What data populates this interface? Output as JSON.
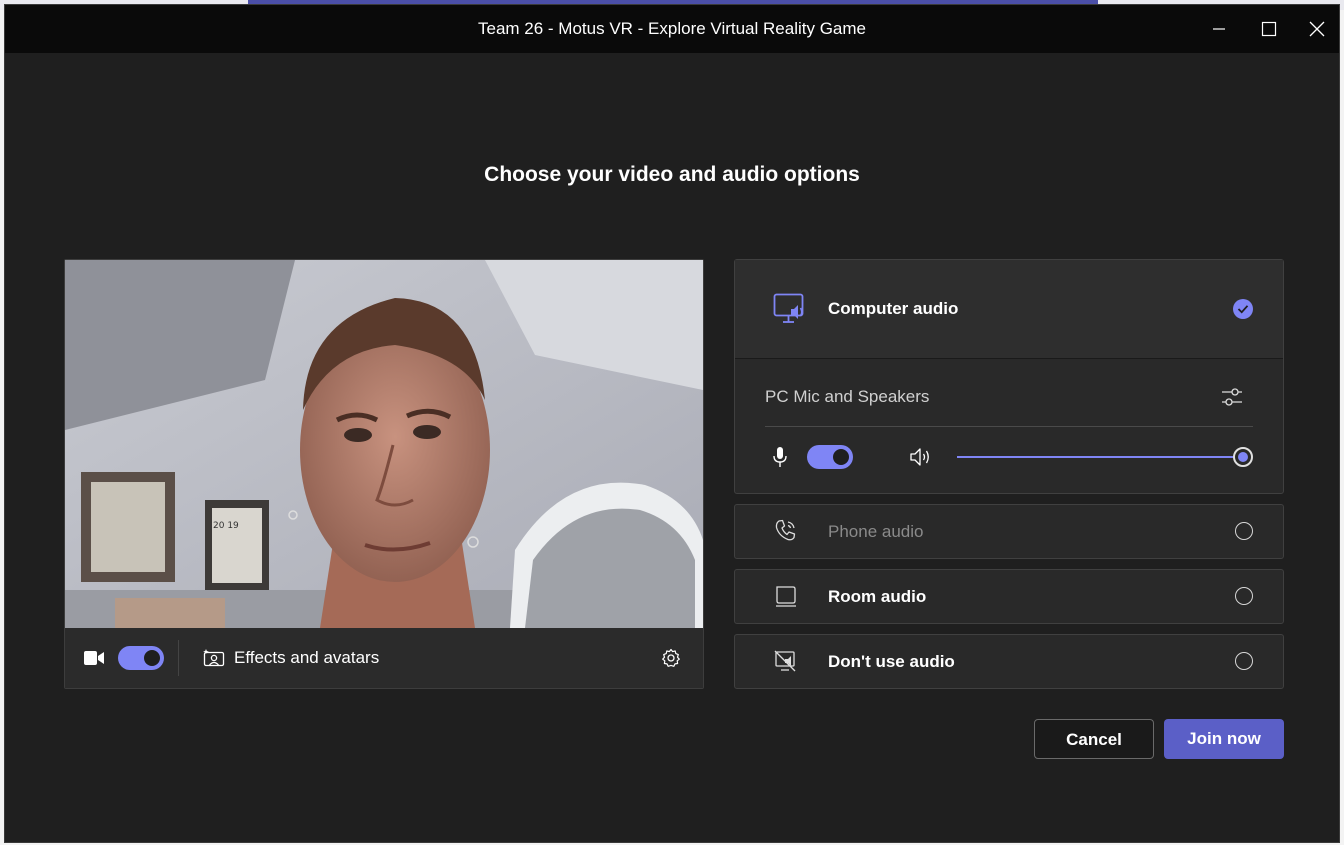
{
  "window": {
    "title": "Team 26 - Motus VR - Explore Virtual Reality Game",
    "controls": [
      "minimize-icon",
      "maximize-icon",
      "close-icon"
    ]
  },
  "heading": "Choose your video and audio options",
  "video": {
    "camera_on": true,
    "effects_label": "Effects and avatars",
    "poster_text": "20 19"
  },
  "audio": {
    "computer": {
      "label": "Computer audio",
      "selected": true
    },
    "device_name": "PC Mic and Speakers",
    "mic_on": true,
    "speaker_volume": 1.0,
    "options": [
      {
        "label": "Phone audio",
        "selected": false,
        "disabled": true
      },
      {
        "label": "Room audio",
        "selected": false
      },
      {
        "label": "Don't use audio",
        "selected": false
      }
    ]
  },
  "buttons": {
    "cancel": "Cancel",
    "join": "Join now"
  },
  "colors": {
    "accent": "#7f85f5",
    "primary_button": "#5b5fc7",
    "window_bg": "#1f1f1f",
    "titlebar_bg": "#0a0a0a"
  }
}
